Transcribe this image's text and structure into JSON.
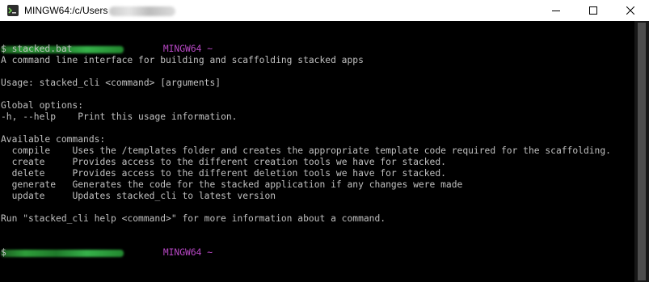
{
  "window": {
    "title": "MINGW64:/c/Users",
    "icon": "mingw-terminal-icon",
    "controls": [
      "minimize-icon",
      "maximize-icon",
      "close-icon"
    ]
  },
  "colors": {
    "background": "#000000",
    "text": "#c0c0c0",
    "prompt_host": "#b948c6",
    "redacted_user": "#2e9e3a",
    "titlebar": "#ffffff"
  },
  "terminal": {
    "prompt_host": "MINGW64",
    "prompt_dir": "~",
    "prompt_symbol": "$",
    "command": "stacked.bat",
    "description": "A command line interface for building and scaffolding stacked apps",
    "usage": "Usage: stacked_cli <command> [arguments]",
    "global_header": "Global options:",
    "global_options": [
      {
        "flag": "-h, --help",
        "description": "Print this usage information."
      }
    ],
    "commands_header": "Available commands:",
    "commands": [
      {
        "name": "compile",
        "description": "Uses the /templates folder and creates the appropriate template code required for the scaffolding."
      },
      {
        "name": "create",
        "description": "Provides access to the different creation tools we have for stacked."
      },
      {
        "name": "delete",
        "description": "Provides access to the different deletion tools we have for stacked."
      },
      {
        "name": "generate",
        "description": "Generates the code for the stacked application if any changes were made"
      },
      {
        "name": "update",
        "description": "Updates stacked_cli to latest version"
      }
    ],
    "footer": "Run \"stacked_cli help <command>\" for more information about a command."
  }
}
